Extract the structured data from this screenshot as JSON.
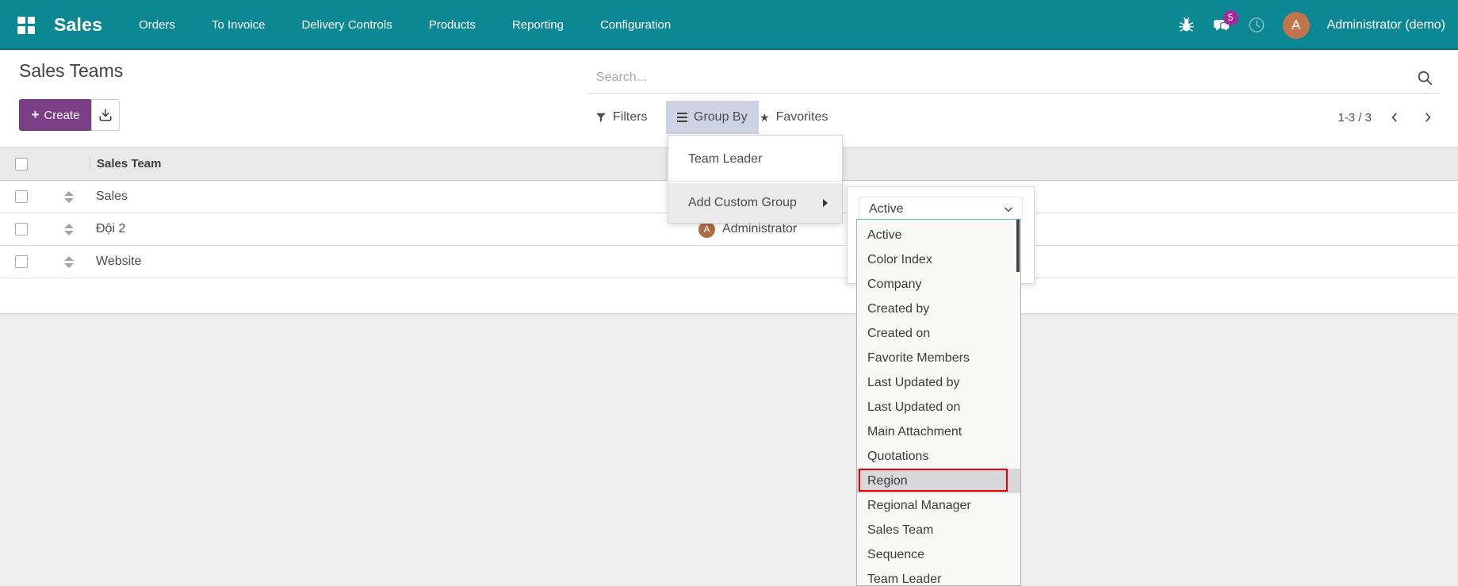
{
  "navbar": {
    "app_name": "Sales",
    "menus": [
      "Orders",
      "To Invoice",
      "Delivery Controls",
      "Products",
      "Reporting",
      "Configuration"
    ],
    "message_count": "5",
    "user_name": "Administrator (demo)",
    "user_avatar_letter": "A"
  },
  "breadcrumb": {
    "title": "Sales Teams"
  },
  "toolbar": {
    "create_label": "Create"
  },
  "search": {
    "placeholder": "Search..."
  },
  "control_panel": {
    "filters_label": "Filters",
    "group_by_label": "Group By",
    "favorites_label": "Favorites",
    "pager_value": "1-3 / 3"
  },
  "group_by_menu": {
    "items": [
      {
        "label": "Team Leader"
      }
    ],
    "add_custom_group_label": "Add Custom Group"
  },
  "custom_group_submenu": {
    "selected_value": "Active",
    "options": [
      "Active",
      "Color Index",
      "Company",
      "Created by",
      "Created on",
      "Favorite Members",
      "Last Updated by",
      "Last Updated on",
      "Main Attachment",
      "Quotations",
      "Region",
      "Regional Manager",
      "Sales Team",
      "Sequence",
      "Team Leader"
    ],
    "highlighted_option": "Region"
  },
  "table": {
    "columns": [
      "Sales Team"
    ],
    "rows": [
      {
        "name": "Sales"
      },
      {
        "name": "Đội 2",
        "leader": {
          "name": "Administrator",
          "avatar_letter": "A"
        }
      },
      {
        "name": "Website"
      }
    ]
  },
  "colors": {
    "navbar_bg": "#0c8794",
    "primary_button": "#7c3f87",
    "group_by_active_bg": "#ccd3e3",
    "message_badge": "#a32b9d",
    "avatar_bg": "#c0764a",
    "annotation_red": "#e60000"
  }
}
